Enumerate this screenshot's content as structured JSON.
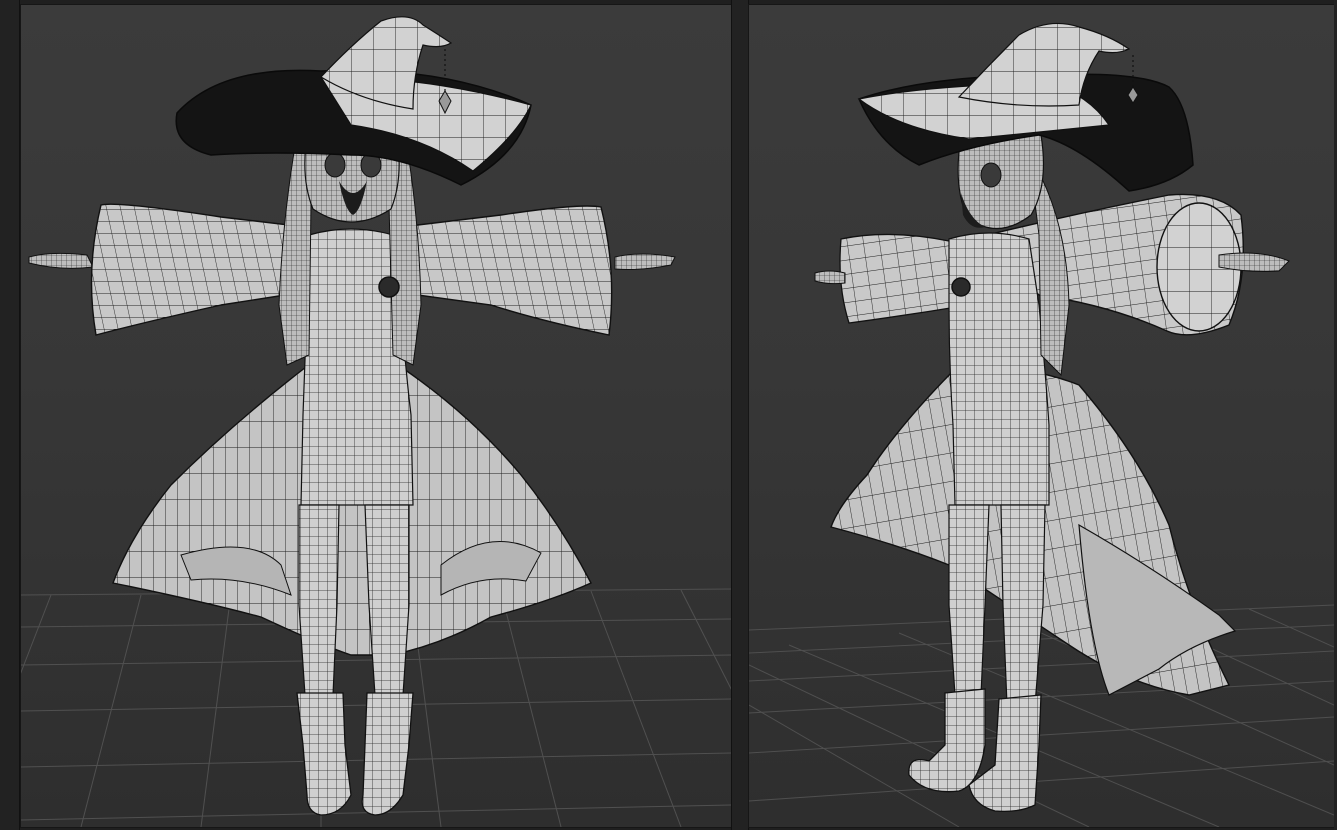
{
  "viewports": [
    {
      "id": "front",
      "title": "",
      "shading": "wireframe-on-shaded"
    },
    {
      "id": "perspective",
      "title": "",
      "shading": "wireframe-on-shaded"
    }
  ],
  "colors": {
    "background_top": "#3b3b3b",
    "background_bottom": "#2e2e2e",
    "grid_line": "#4e4e4e",
    "mesh_fill": "#cfcfcf",
    "mesh_wire": "#111111",
    "hat_brim_dark": "#141414"
  },
  "icons": [
    "front-view",
    "perspective-view"
  ]
}
